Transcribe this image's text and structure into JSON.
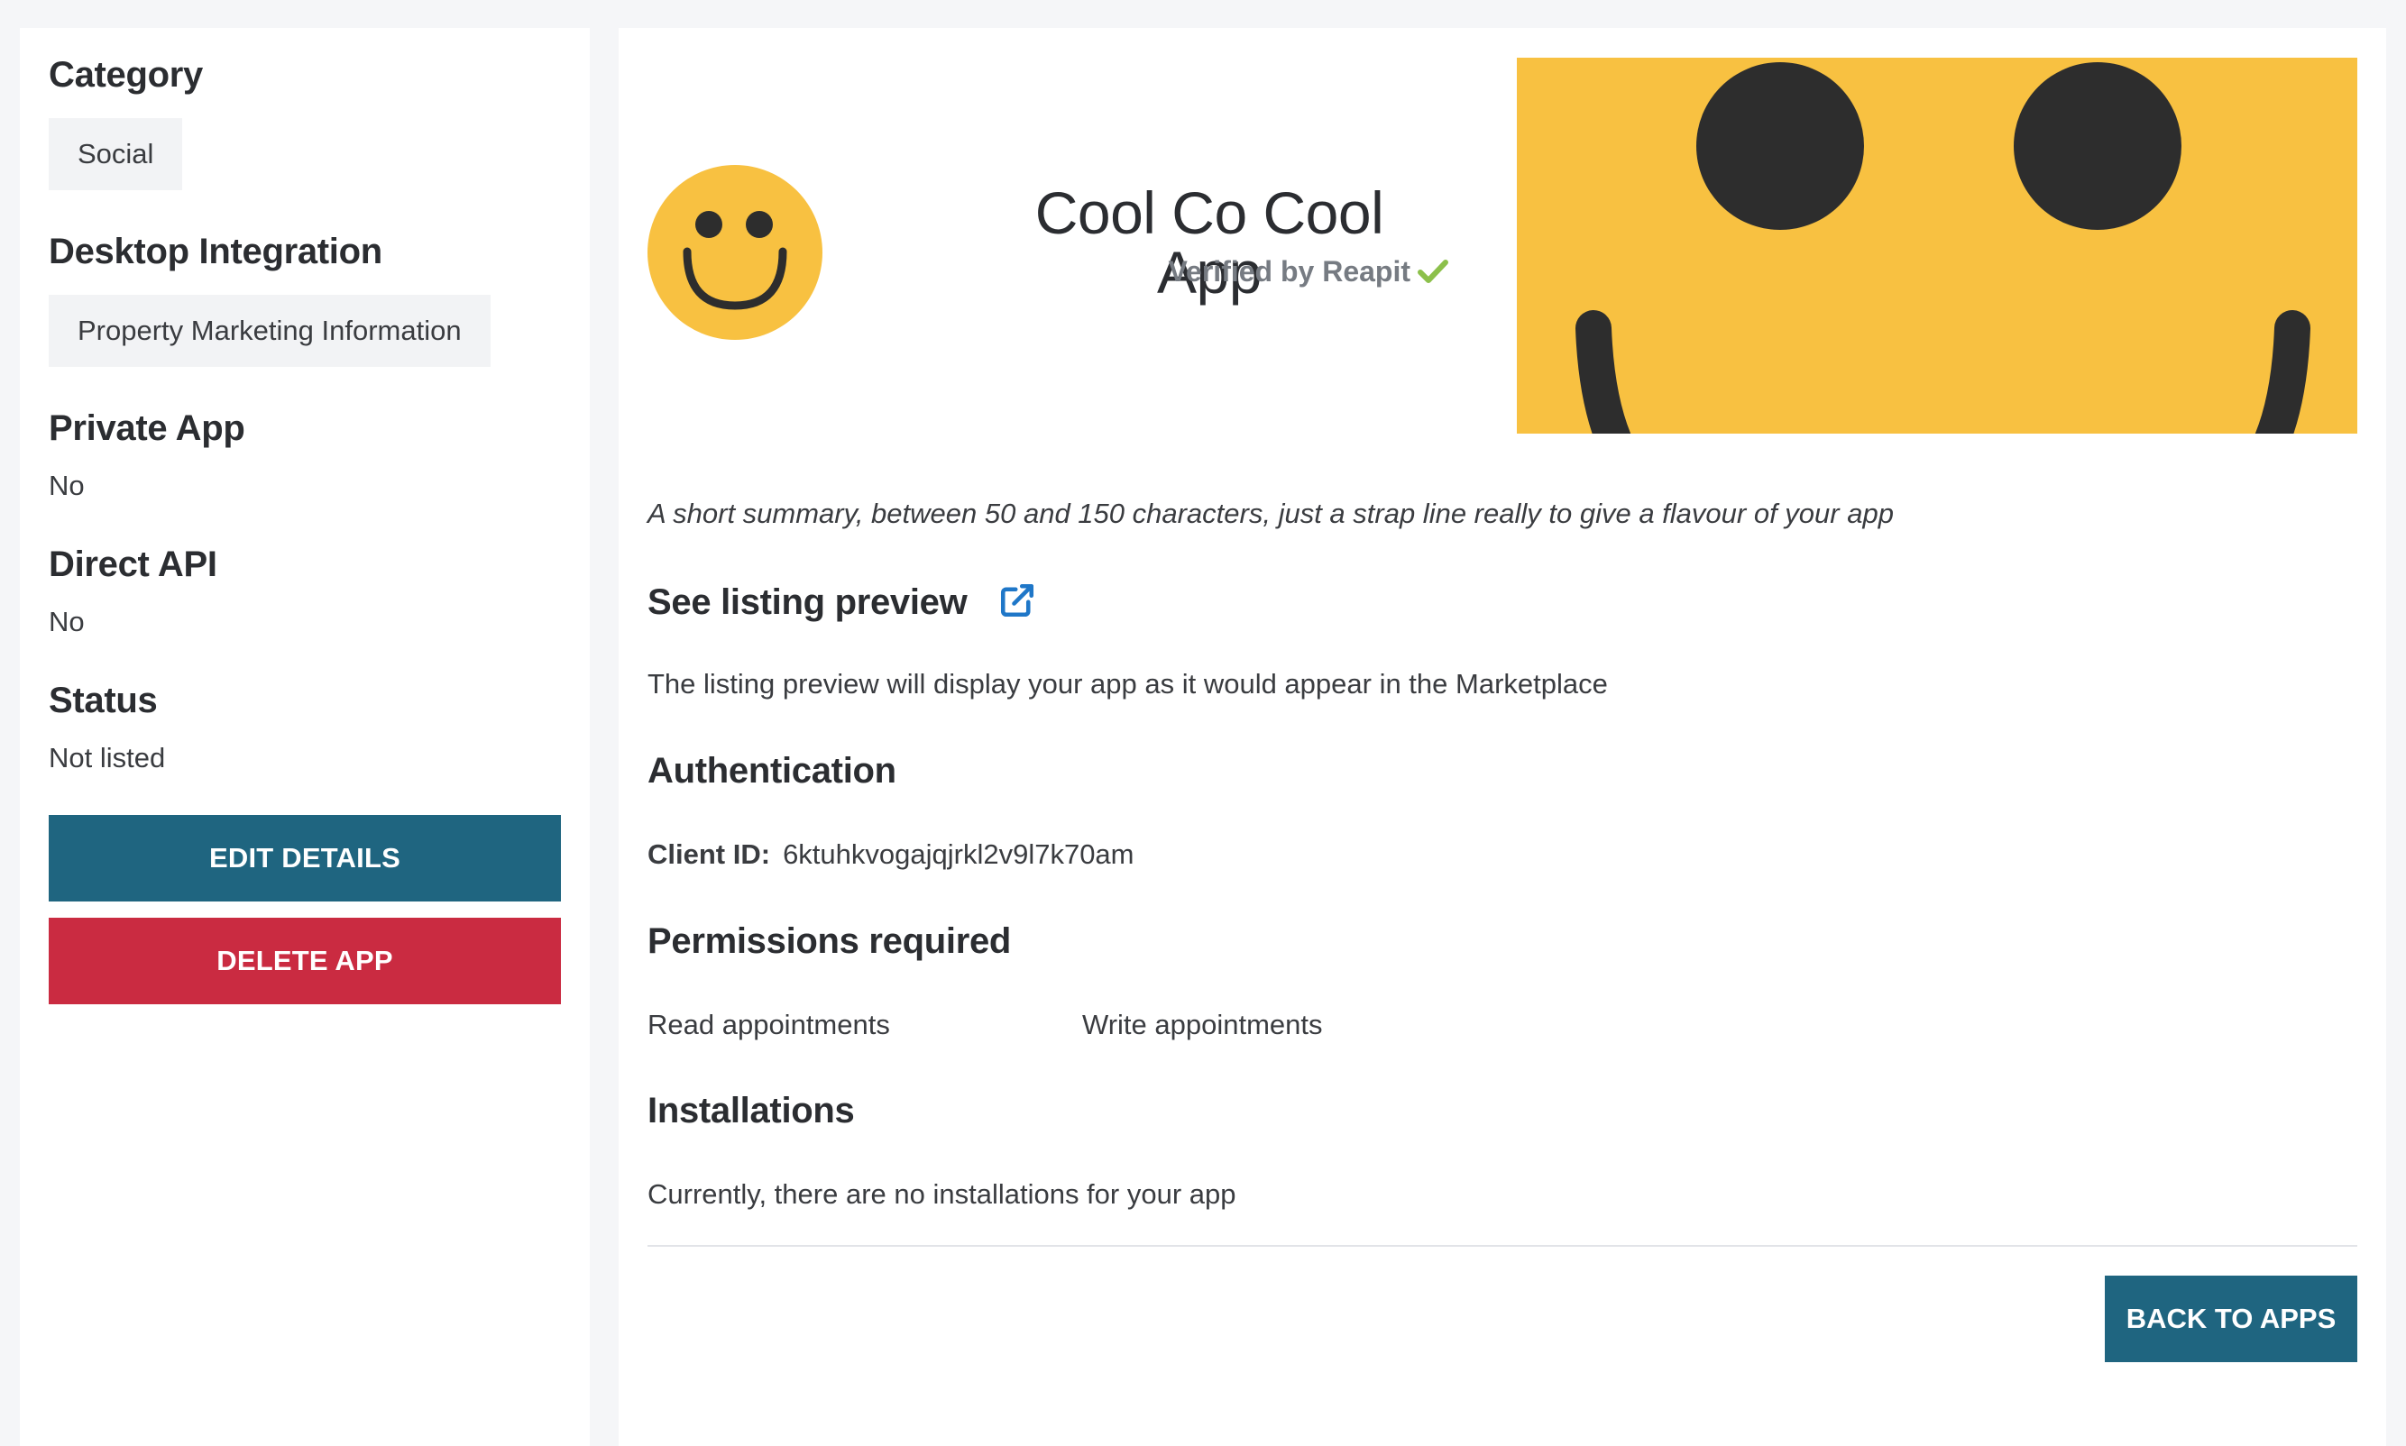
{
  "sidebar": {
    "category": {
      "heading": "Category",
      "value": "Social"
    },
    "desktop_integration": {
      "heading": "Desktop Integration",
      "value": "Property Marketing Information"
    },
    "private_app": {
      "heading": "Private App",
      "value": "No"
    },
    "direct_api": {
      "heading": "Direct API",
      "value": "No"
    },
    "status": {
      "heading": "Status",
      "value": "Not listed"
    },
    "edit_label": "EDIT DETAILS",
    "delete_label": "DELETE APP"
  },
  "app": {
    "name": "Cool Co Cool App",
    "verified_text": "Verified by Reapit",
    "summary": "A short summary, between 50 and 150 characters, just a strap line really to give a flavour of your app",
    "logo_icon": "smiley-face-icon",
    "verified_icon": "checkmark-icon"
  },
  "listing_preview": {
    "title": "See listing preview",
    "description": "The listing preview will display your app as it would appear in the Marketplace",
    "icon": "external-link-icon"
  },
  "authentication": {
    "title": "Authentication",
    "client_id_label": "Client ID:",
    "client_id": "6ktuhkvogajqjrkl2v9l7k70am"
  },
  "permissions": {
    "title": "Permissions required",
    "items": [
      "Read appointments",
      "Write appointments"
    ]
  },
  "installations": {
    "title": "Installations",
    "text": "Currently, there are no installations for your app"
  },
  "back_label": "BACK TO APPS",
  "colors": {
    "primary": "#1f6580",
    "danger": "#ca2b41",
    "accent_yellow": "#f8c141",
    "verified_green": "#8cc04b",
    "link_blue": "#1f77c8"
  }
}
